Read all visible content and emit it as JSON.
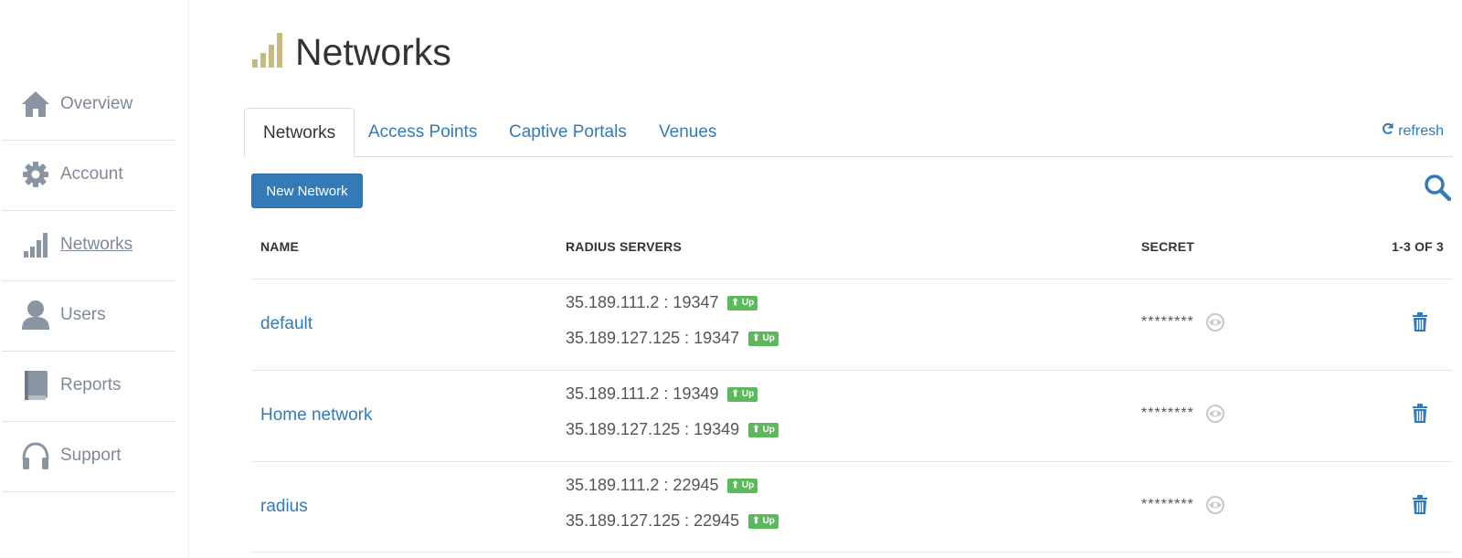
{
  "sidebar": {
    "items": [
      {
        "label": "Overview",
        "icon": "home-icon"
      },
      {
        "label": "Account",
        "icon": "gear-icon"
      },
      {
        "label": "Networks",
        "icon": "signal-bars-icon",
        "active": true
      },
      {
        "label": "Users",
        "icon": "user-icon"
      },
      {
        "label": "Reports",
        "icon": "book-icon"
      },
      {
        "label": "Support",
        "icon": "headphones-icon"
      }
    ]
  },
  "page": {
    "title": "Networks",
    "title_icon": "signal-bars-icon",
    "title_icon_color": "#c8b97f"
  },
  "tabs": [
    {
      "label": "Networks",
      "active": true
    },
    {
      "label": "Access Points"
    },
    {
      "label": "Captive Portals"
    },
    {
      "label": "Venues"
    }
  ],
  "refresh_label": "refresh",
  "new_network_label": "New Network",
  "table": {
    "headers": {
      "name": "NAME",
      "radius": "RADIUS SERVERS",
      "secret": "SECRET",
      "count": "1-3 OF 3"
    },
    "rows": [
      {
        "name": "default",
        "servers": [
          {
            "address": "35.189.111.2 : 19347",
            "status": "Up"
          },
          {
            "address": "35.189.127.125 : 19347",
            "status": "Up"
          }
        ],
        "secret": "********"
      },
      {
        "name": "Home network",
        "servers": [
          {
            "address": "35.189.111.2 : 19349",
            "status": "Up"
          },
          {
            "address": "35.189.127.125 : 19349",
            "status": "Up"
          }
        ],
        "secret": "********"
      },
      {
        "name": "radius",
        "servers": [
          {
            "address": "35.189.111.2 : 22945",
            "status": "Up"
          },
          {
            "address": "35.189.127.125 : 22945",
            "status": "Up"
          }
        ],
        "secret": "********"
      }
    ]
  },
  "colors": {
    "link": "#337ab7",
    "status_up": "#5cb85c",
    "sidebar_icon": "#8a95a3"
  }
}
